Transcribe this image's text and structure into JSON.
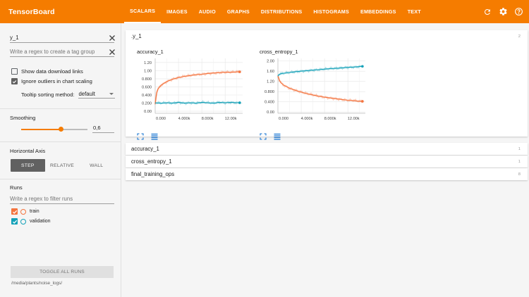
{
  "app": {
    "title": "TensorBoard"
  },
  "tabs": [
    {
      "label": "SCALARS",
      "active": true
    },
    {
      "label": "IMAGES"
    },
    {
      "label": "AUDIO"
    },
    {
      "label": "GRAPHS"
    },
    {
      "label": "DISTRIBUTIONS"
    },
    {
      "label": "HISTOGRAMS"
    },
    {
      "label": "EMBEDDINGS"
    },
    {
      "label": "TEXT"
    }
  ],
  "top_icons": [
    "refresh-icon",
    "settings-icon",
    "help-icon"
  ],
  "colors": {
    "accent": "#f57c00",
    "train": "#f4743f",
    "validation": "#13a1b8",
    "button": "#616161"
  },
  "sidebar": {
    "tag_filter_value": "y_1",
    "tag_group_placeholder": "Write a regex to create a tag group",
    "show_download": {
      "label": "Show data download links",
      "checked": false
    },
    "ignore_outliers": {
      "label": "Ignore outliers in chart scaling",
      "checked": true
    },
    "tooltip_sort": {
      "label": "Tooltip sorting method:",
      "value": "default"
    },
    "smoothing": {
      "title": "Smoothing",
      "value": "0,6",
      "fraction": 0.6
    },
    "horizontal_axis": {
      "title": "Horizontal Axis",
      "options": [
        "STEP",
        "RELATIVE",
        "WALL"
      ],
      "selected": "STEP"
    },
    "runs": {
      "title": "Runs",
      "filter_placeholder": "Write a regex to filter runs",
      "items": [
        {
          "name": "train",
          "checked": true,
          "color": "#f4743f"
        },
        {
          "name": "validation",
          "checked": true,
          "color": "#13a1b8"
        }
      ]
    },
    "toggle_all": "TOGGLE ALL RUNS",
    "logdir": "/media/plants/noise_logs/"
  },
  "groups": [
    {
      "name": ".y_1",
      "count": "2",
      "expanded": true
    },
    {
      "name": "accuracy_1",
      "count": "1"
    },
    {
      "name": "cross_entropy_1",
      "count": "1"
    },
    {
      "name": "final_training_ops",
      "count": "8"
    }
  ],
  "chart_data": [
    {
      "type": "line",
      "title": "accuracy_1",
      "xlabel": "",
      "ylabel": "",
      "x_ticks": [
        "0.000",
        "4.000k",
        "8.000k",
        "12.00k"
      ],
      "y_ticks": [
        "0.00",
        "0.200",
        "0.400",
        "0.600",
        "0.800",
        "1.00",
        "1.20"
      ],
      "xlim": [
        0,
        15000
      ],
      "ylim": [
        -0.05,
        1.3
      ],
      "grid": true,
      "series": [
        {
          "name": "train",
          "color": "#f4743f",
          "x": [
            0,
            250,
            500,
            1000,
            2000,
            3000,
            4000,
            5000,
            6000,
            7000,
            8000,
            9000,
            10000,
            11000,
            12000,
            13000,
            14000,
            14500
          ],
          "y": [
            0.18,
            0.46,
            0.55,
            0.64,
            0.73,
            0.79,
            0.83,
            0.86,
            0.88,
            0.9,
            0.91,
            0.93,
            0.94,
            0.95,
            0.96,
            0.96,
            0.97,
            0.97
          ]
        },
        {
          "name": "validation",
          "color": "#13a1b8",
          "x": [
            0,
            1000,
            2000,
            3000,
            4000,
            5000,
            6000,
            7000,
            8000,
            9000,
            10000,
            11000,
            12000,
            13000,
            14000,
            14500
          ],
          "y": [
            0.21,
            0.2,
            0.21,
            0.2,
            0.22,
            0.2,
            0.21,
            0.2,
            0.22,
            0.21,
            0.2,
            0.22,
            0.21,
            0.22,
            0.21,
            0.21
          ]
        }
      ]
    },
    {
      "type": "line",
      "title": "cross_entropy_1",
      "xlabel": "",
      "ylabel": "",
      "x_ticks": [
        "0.000",
        "4.000k",
        "8.000k",
        "12.00k"
      ],
      "y_ticks": [
        "0.00",
        "0.400",
        "0.800",
        "1.20",
        "1.60",
        "2.00"
      ],
      "xlim": [
        0,
        15000
      ],
      "ylim": [
        -0.05,
        2.1
      ],
      "grid": true,
      "series": [
        {
          "name": "train",
          "color": "#f4743f",
          "x": [
            0,
            250,
            500,
            1000,
            2000,
            3000,
            4000,
            5000,
            6000,
            7000,
            8000,
            9000,
            10000,
            11000,
            12000,
            13000,
            14000,
            14500
          ],
          "y": [
            1.42,
            1.25,
            1.15,
            1.05,
            0.93,
            0.85,
            0.78,
            0.72,
            0.67,
            0.62,
            0.58,
            0.55,
            0.52,
            0.49,
            0.46,
            0.45,
            0.42,
            0.42
          ]
        },
        {
          "name": "validation",
          "color": "#13a1b8",
          "x": [
            0,
            250,
            500,
            1000,
            2000,
            3000,
            4000,
            5000,
            6000,
            7000,
            8000,
            9000,
            10000,
            11000,
            12000,
            13000,
            14000,
            14500
          ],
          "y": [
            1.42,
            1.48,
            1.5,
            1.52,
            1.55,
            1.58,
            1.6,
            1.62,
            1.64,
            1.66,
            1.68,
            1.7,
            1.71,
            1.73,
            1.75,
            1.76,
            1.78,
            1.79
          ]
        }
      ]
    }
  ]
}
